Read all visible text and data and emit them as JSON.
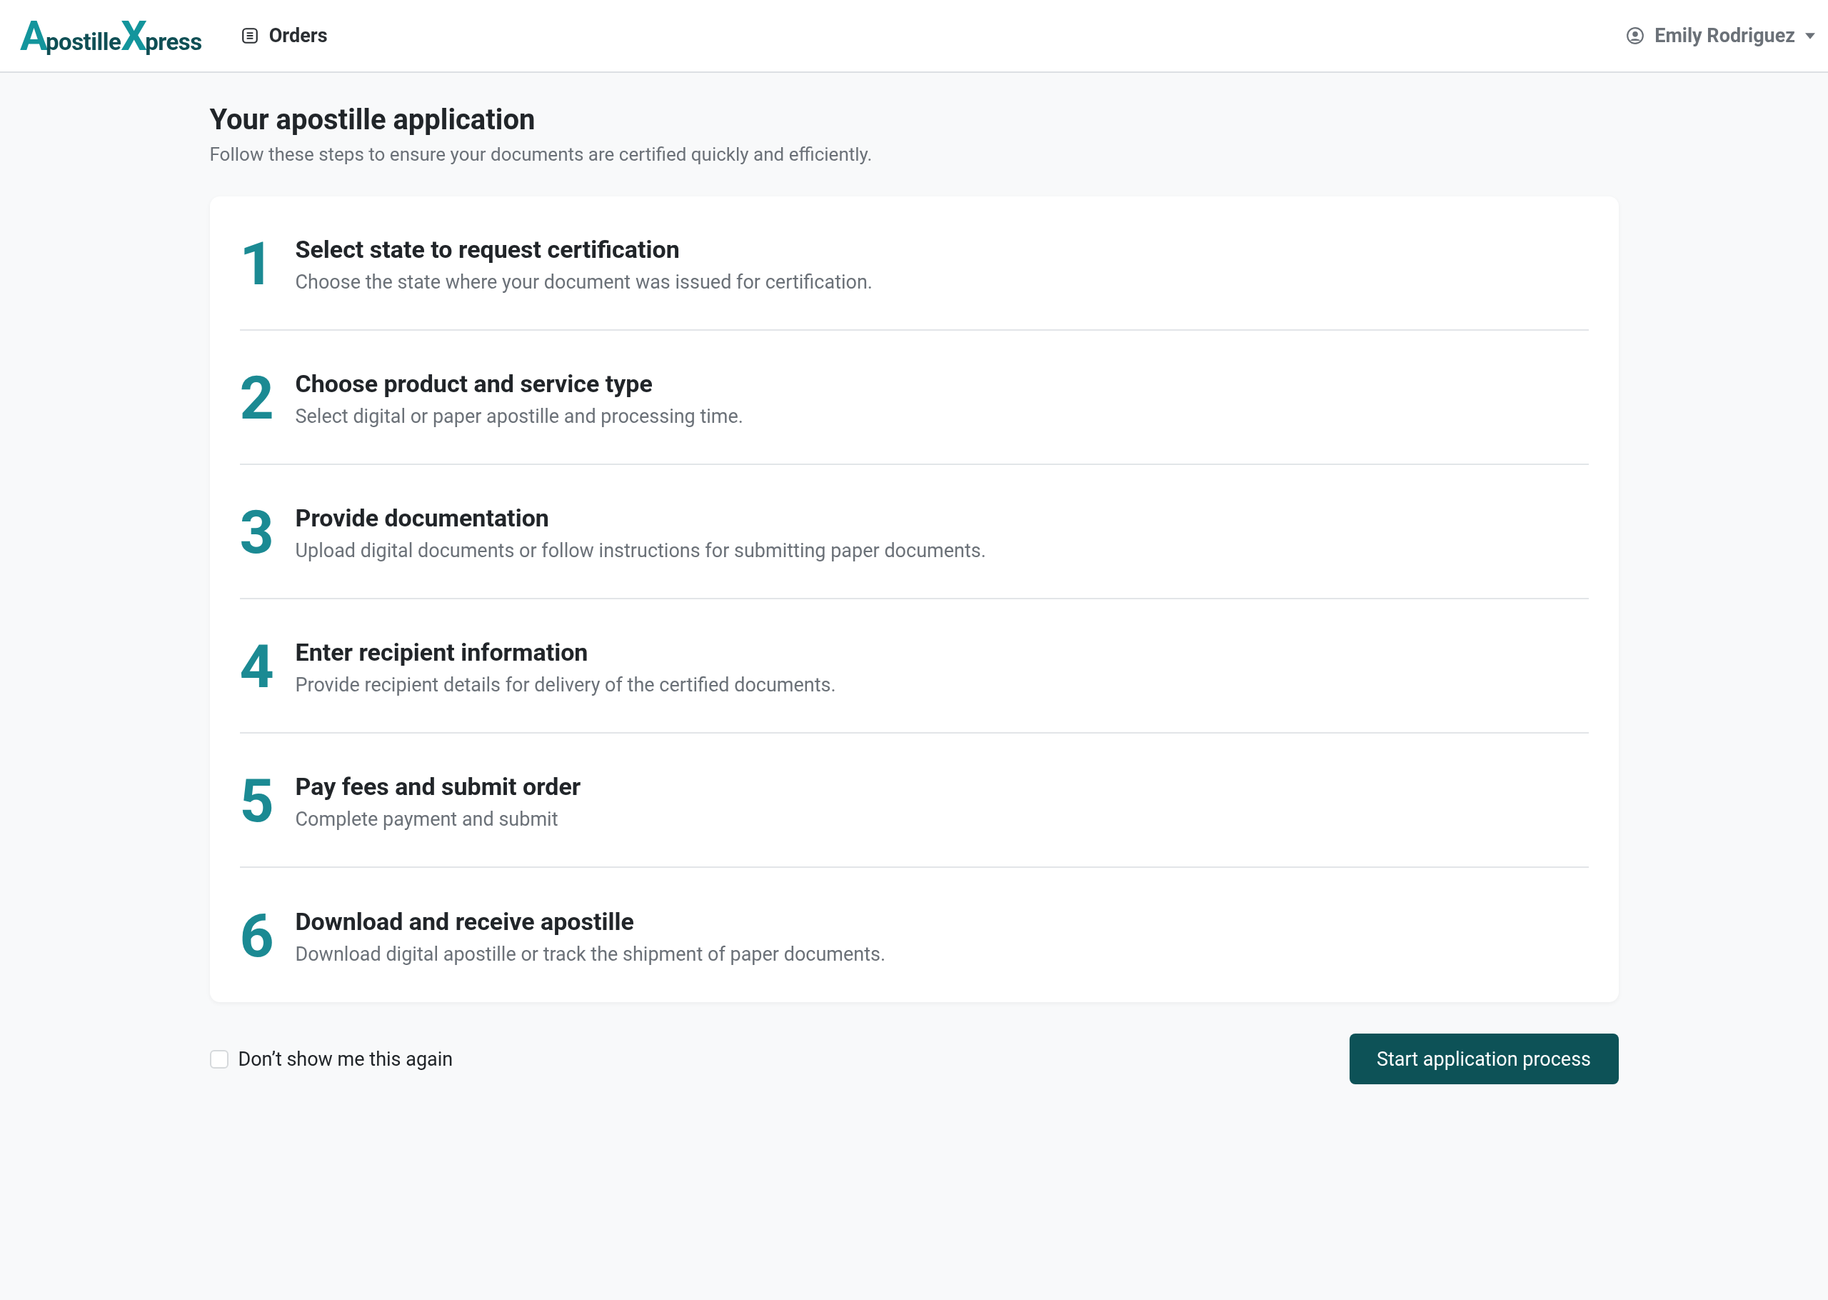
{
  "header": {
    "logo": [
      {
        "text": "A",
        "kind": "initial"
      },
      {
        "text": "postille",
        "kind": "plain"
      },
      {
        "text": "X",
        "kind": "initial"
      },
      {
        "text": "press",
        "kind": "plain"
      }
    ],
    "nav": [
      {
        "label": "Orders"
      }
    ],
    "user": {
      "name": "Emily Rodriguez"
    }
  },
  "page": {
    "title": "Your apostille application",
    "subtitle": "Follow these steps to ensure your documents are certified quickly and efficiently."
  },
  "steps": [
    {
      "number": "1",
      "title": "Select state to request certification",
      "description": "Choose the state where your document was issued for certification."
    },
    {
      "number": "2",
      "title": "Choose product and service type",
      "description": "Select digital or paper apostille and processing time."
    },
    {
      "number": "3",
      "title": "Provide documentation",
      "description": "Upload digital documents or follow instructions for submitting paper documents."
    },
    {
      "number": "4",
      "title": "Enter recipient information",
      "description": "Provide recipient details for delivery of the certified documents."
    },
    {
      "number": "5",
      "title": "Pay fees and submit order",
      "description": "Complete payment and submit"
    },
    {
      "number": "6",
      "title": "Download and receive apostille",
      "description": "Download digital apostille or track the shipment of paper documents."
    }
  ],
  "footer": {
    "checkbox": {
      "label": "Don’t show me this again",
      "checked": false
    },
    "button": "Start application process"
  }
}
